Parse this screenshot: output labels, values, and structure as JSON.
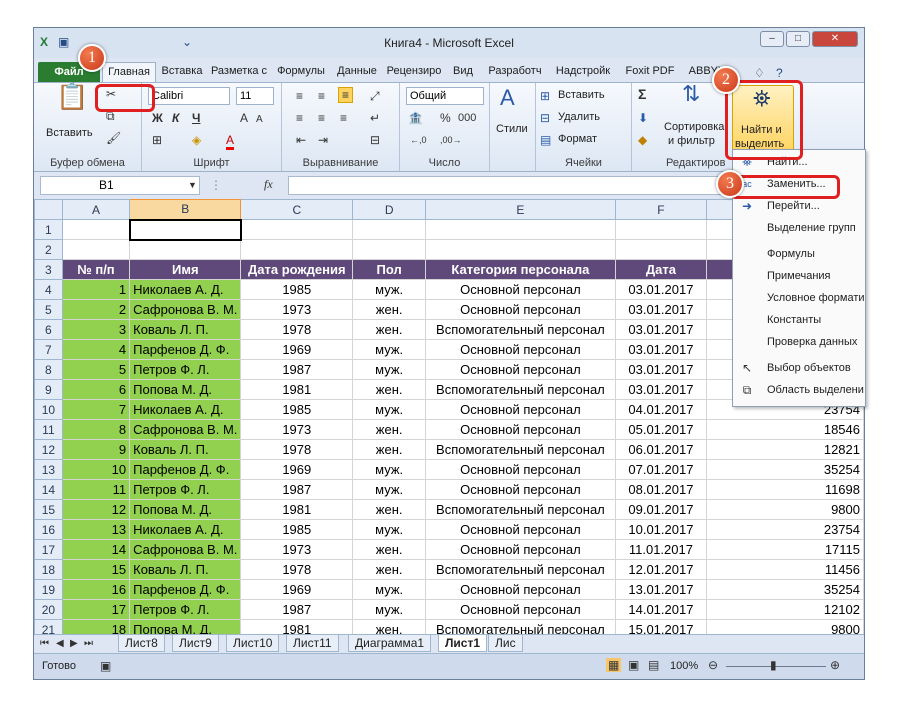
{
  "window": {
    "title": "Книга4 - Microsoft Excel"
  },
  "tabs": [
    "Файл",
    "Главная",
    "Вставка",
    "Разметка с",
    "Формулы",
    "Данные",
    "Рецензиро",
    "Вид",
    "Разработч",
    "Надстройк",
    "Foxit PDF",
    "ABBYY"
  ],
  "ribbon": {
    "clipboard": {
      "label": "Буфер обмена",
      "paste": "Вставить"
    },
    "font": {
      "label": "Шрифт",
      "name": "Calibri",
      "size": "11",
      "bold": "Ж",
      "italic": "К",
      "underline": "Ч",
      "grow": "A",
      "shrink": "A"
    },
    "alignment": {
      "label": "Выравнивание"
    },
    "number": {
      "label": "Число",
      "format": "Общий",
      "pct": "%",
      "thousands": "000"
    },
    "styles": {
      "label": "Стили"
    },
    "cells": {
      "label": "Ячейки",
      "insert": "Вставить",
      "delete": "Удалить",
      "format": "Формат"
    },
    "editing": {
      "label": "Редактиров",
      "sigma": "Σ",
      "sort": "Сортировка",
      "filter": "и фильтр",
      "find": "Найти и",
      "select": "выделить"
    }
  },
  "formula_bar": {
    "name_box": "B1",
    "fx": "fx"
  },
  "columns": [
    "A",
    "B",
    "C",
    "D",
    "E",
    "F",
    "G"
  ],
  "table_headers": [
    "№ п/п",
    "Имя",
    "Дата рождения",
    "Пол",
    "Категория персонала",
    "Дата",
    "Су"
  ],
  "rows": [
    [
      "1",
      "Николаев А. Д.",
      "1985",
      "муж.",
      "Основной персонал",
      "03.01.2017",
      ""
    ],
    [
      "2",
      "Сафронова В. М.",
      "1973",
      "жен.",
      "Основной персонал",
      "03.01.2017",
      ""
    ],
    [
      "3",
      "Коваль Л. П.",
      "1978",
      "жен.",
      "Вспомогательный персонал",
      "03.01.2017",
      ""
    ],
    [
      "4",
      "Парфенов Д. Ф.",
      "1969",
      "муж.",
      "Основной персонал",
      "03.01.2017",
      ""
    ],
    [
      "5",
      "Петров Ф. Л.",
      "1987",
      "муж.",
      "Основной персонал",
      "03.01.2017",
      ""
    ],
    [
      "6",
      "Попова М. Д.",
      "1981",
      "жен.",
      "Вспомогательный персонал",
      "03.01.2017",
      ""
    ],
    [
      "7",
      "Николаев А. Д.",
      "1985",
      "муж.",
      "Основной персонал",
      "04.01.2017",
      "23754"
    ],
    [
      "8",
      "Сафронова В. М.",
      "1973",
      "жен.",
      "Основной персонал",
      "05.01.2017",
      "18546"
    ],
    [
      "9",
      "Коваль Л. П.",
      "1978",
      "жен.",
      "Вспомогательный персонал",
      "06.01.2017",
      "12821"
    ],
    [
      "10",
      "Парфенов Д. Ф.",
      "1969",
      "муж.",
      "Основной персонал",
      "07.01.2017",
      "35254"
    ],
    [
      "11",
      "Петров Ф. Л.",
      "1987",
      "муж.",
      "Основной персонал",
      "08.01.2017",
      "11698"
    ],
    [
      "12",
      "Попова М. Д.",
      "1981",
      "жен.",
      "Вспомогательный персонал",
      "09.01.2017",
      "9800"
    ],
    [
      "13",
      "Николаев А. Д.",
      "1985",
      "муж.",
      "Основной персонал",
      "10.01.2017",
      "23754"
    ],
    [
      "14",
      "Сафронова В. М.",
      "1973",
      "жен.",
      "Основной персонал",
      "11.01.2017",
      "17115"
    ],
    [
      "15",
      "Коваль Л. П.",
      "1978",
      "жен.",
      "Вспомогательный персонал",
      "12.01.2017",
      "11456"
    ],
    [
      "16",
      "Парфенов Д. Ф.",
      "1969",
      "муж.",
      "Основной персонал",
      "13.01.2017",
      "35254"
    ],
    [
      "17",
      "Петров Ф. Л.",
      "1987",
      "муж.",
      "Основной персонал",
      "14.01.2017",
      "12102"
    ],
    [
      "18",
      "Попова М. Д.",
      "1981",
      "жен.",
      "Вспомогательный персонал",
      "15.01.2017",
      "9800"
    ]
  ],
  "row_numbers": [
    "1",
    "2",
    "3",
    "4",
    "5",
    "6",
    "7",
    "8",
    "9",
    "10",
    "11",
    "12",
    "13",
    "14",
    "15",
    "16",
    "17",
    "18",
    "19",
    "20",
    "21"
  ],
  "sheet_tabs": [
    "Лист8",
    "Лист9",
    "Лист10",
    "Лист11",
    "Диаграмма1",
    "Лист1",
    "Лис"
  ],
  "status": {
    "ready": "Готово",
    "zoom": "100%"
  },
  "menu": {
    "items": [
      "Найти...",
      "Заменить...",
      "Перейти...",
      "Выделение групп",
      "Формулы",
      "Примечания",
      "Условное формати",
      "Константы",
      "Проверка данных",
      "Выбор объектов",
      "Область выделени"
    ]
  },
  "badges": [
    "1",
    "2",
    "3"
  ],
  "colors": {
    "header_bg": "#5f497a",
    "green_fill": "#92d050",
    "file_tab": "#2a7d30",
    "badge": "#d9441f"
  }
}
